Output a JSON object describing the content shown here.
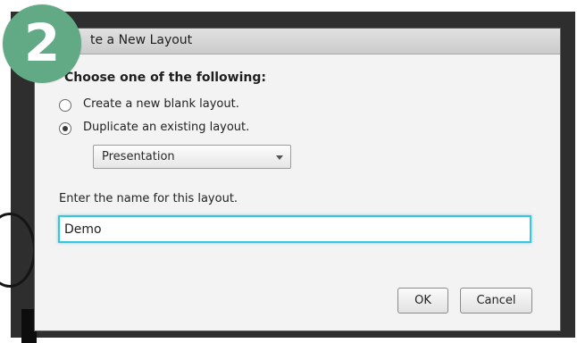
{
  "dialog": {
    "title": "te a New Layout",
    "step_number": "2",
    "heading": "Choose one of the following:",
    "options": [
      {
        "label": "Create a new blank layout.",
        "selected": false
      },
      {
        "label": "Duplicate an existing layout.",
        "selected": true
      }
    ],
    "layout_select": {
      "value": "Presentation"
    },
    "name_field": {
      "label": "Enter the name for this layout.",
      "value": "Demo"
    },
    "buttons": {
      "ok": "OK",
      "cancel": "Cancel"
    }
  },
  "colors": {
    "badge": "#62a986",
    "focus_ring": "#3bc4e0",
    "backdrop": "#2e2e2e"
  }
}
